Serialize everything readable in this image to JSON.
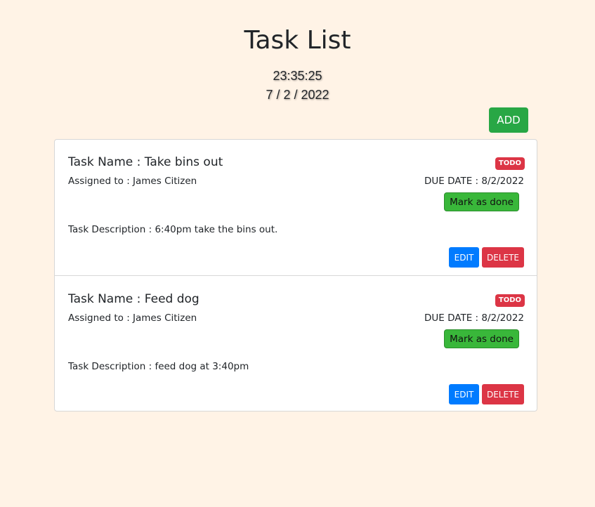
{
  "header": {
    "title": "Task List",
    "time": "23:35:25",
    "date": "7 / 2 / 2022",
    "add_label": "ADD"
  },
  "tasks": [
    {
      "name": "Task Name : Take bins out",
      "status": "TODO",
      "assigned": "Assigned to : James Citizen",
      "due": "DUE DATE : 8/2/2022",
      "done_label": "Mark as done",
      "description": "Task Description : 6:40pm take the bins out.",
      "edit_label": "EDIT",
      "delete_label": "DELETE"
    },
    {
      "name": "Task Name : Feed dog",
      "status": "TODO",
      "assigned": "Assigned to : James Citizen",
      "due": "DUE DATE : 8/2/2022",
      "done_label": "Mark as done",
      "description": "Task Description : feed dog at 3:40pm",
      "edit_label": "EDIT",
      "delete_label": "DELETE"
    }
  ],
  "colors": {
    "background": "#fff3e6",
    "add_button": "#28a745",
    "status_badge": "#dc3545",
    "done_button": "#39b73a",
    "edit_button": "#007bff",
    "delete_button": "#dc3545"
  }
}
